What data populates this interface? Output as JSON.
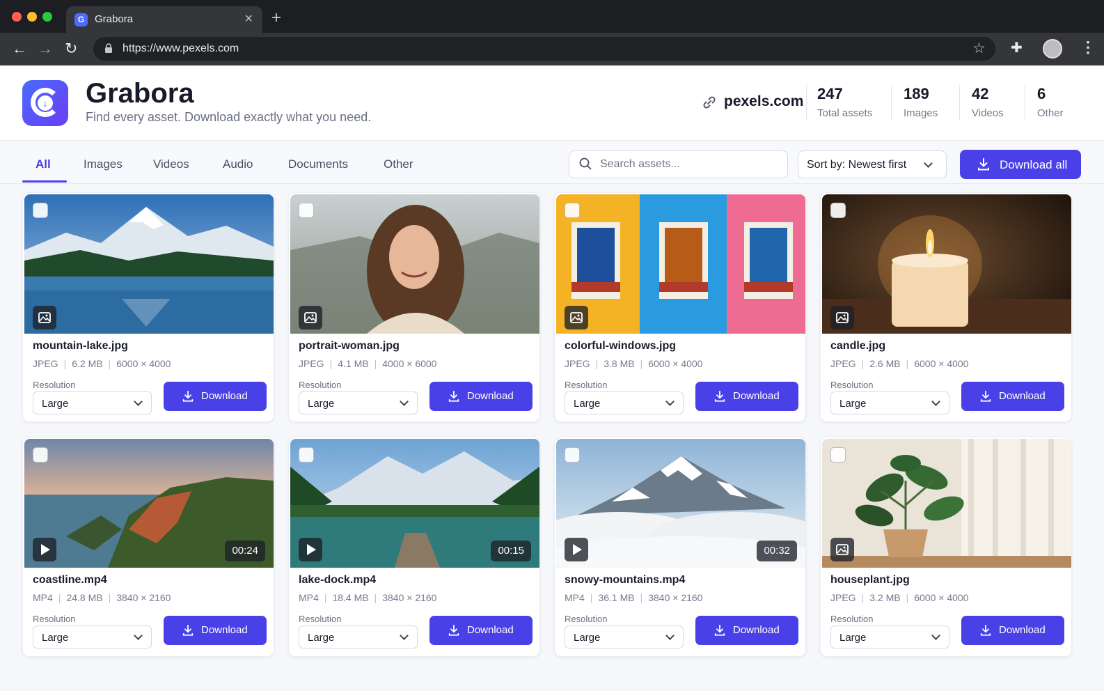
{
  "browser": {
    "tab_title": "Grabora",
    "tab_favicon": "G",
    "url": "https://www.pexels.com"
  },
  "app": {
    "name": "Grabora",
    "tagline": "Find every asset. Download exactly what you need.",
    "site": "pexels.com",
    "accent_color": "#4a40e8"
  },
  "stats": [
    {
      "value": "247",
      "label": "Total assets"
    },
    {
      "value": "189",
      "label": "Images"
    },
    {
      "value": "42",
      "label": "Videos"
    },
    {
      "value": "6",
      "label": "Other"
    }
  ],
  "filters": {
    "tabs": [
      "All",
      "Images",
      "Videos",
      "Audio",
      "Documents",
      "Other"
    ],
    "active_tab": "All",
    "search_placeholder": "Search assets...",
    "sort_label": "Sort by: Newest first",
    "download_all_label": "Download all"
  },
  "cards": [
    {
      "name": "mountain-lake.jpg",
      "format": "JPEG",
      "size": "6.2 MB",
      "dims": "6000 × 4000",
      "type_icon": "image-icon",
      "resolution_label": "Resolution",
      "resolution": "Large",
      "download_label": "Download"
    },
    {
      "name": "portrait-woman.jpg",
      "format": "JPEG",
      "size": "4.1 MB",
      "dims": "4000 × 6000",
      "type_icon": "image-icon",
      "resolution_label": "Resolution",
      "resolution": "Large",
      "download_label": "Download"
    },
    {
      "name": "colorful-windows.jpg",
      "format": "JPEG",
      "size": "3.8 MB",
      "dims": "6000 × 4000",
      "type_icon": "image-icon",
      "resolution_label": "Resolution",
      "resolution": "Large",
      "download_label": "Download"
    },
    {
      "name": "candle.jpg",
      "format": "JPEG",
      "size": "2.6 MB",
      "dims": "6000 × 4000",
      "type_icon": "image-icon",
      "resolution_label": "Resolution",
      "resolution": "Large",
      "download_label": "Download"
    },
    {
      "name": "coastline.mp4",
      "format": "MP4",
      "size": "24.8 MB",
      "dims": "3840 × 2160",
      "type_icon": "play-icon",
      "duration": "00:24",
      "resolution_label": "Resolution",
      "resolution": "Large",
      "download_label": "Download"
    },
    {
      "name": "lake-dock.mp4",
      "format": "MP4",
      "size": "18.4 MB",
      "dims": "3840 × 2160",
      "type_icon": "play-icon",
      "duration": "00:15",
      "resolution_label": "Resolution",
      "resolution": "Large",
      "download_label": "Download"
    },
    {
      "name": "snowy-mountains.mp4",
      "format": "MP4",
      "size": "36.1 MB",
      "dims": "3840 × 2160",
      "type_icon": "play-icon",
      "duration": "00:32",
      "resolution_label": "Resolution",
      "resolution": "Large",
      "download_label": "Download"
    },
    {
      "name": "houseplant.jpg",
      "format": "JPEG",
      "size": "3.2 MB",
      "dims": "6000 × 4000",
      "type_icon": "image-icon",
      "resolution_label": "Resolution",
      "resolution": "Large",
      "download_label": "Download"
    }
  ]
}
